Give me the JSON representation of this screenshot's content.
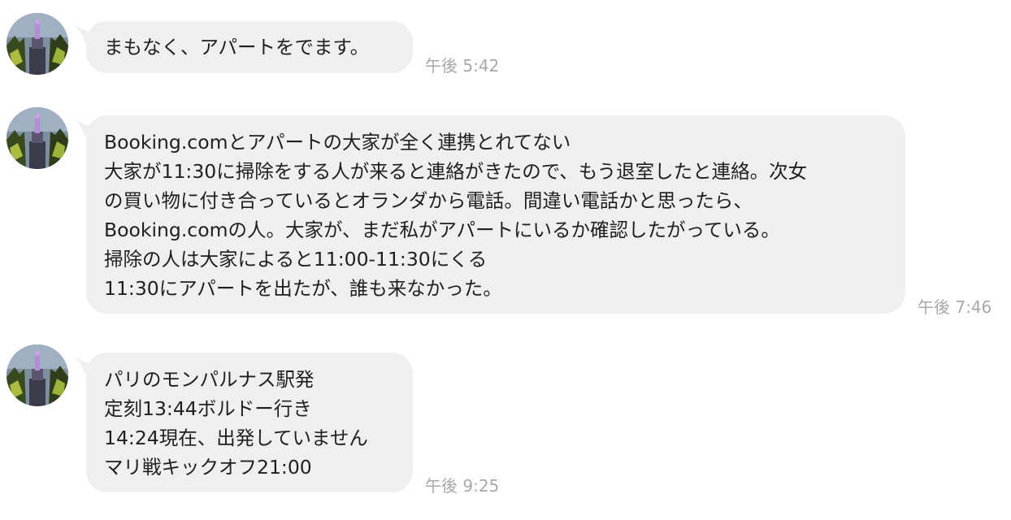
{
  "messages": [
    {
      "lines": [
        "まもなく、アパートをでます。"
      ],
      "time": "午後 5:42"
    },
    {
      "lines": [
        "Booking.comとアパートの大家が全く連携とれてない",
        "大家が11:30に掃除をする人が来ると連絡がきたので、もう退室したと連絡。次女",
        "の買い物に付き合っているとオランダから電話。間違い電話かと思ったら、",
        "Booking.comの人。大家が、まだ私がアパートにいるか確認したがっている。",
        "掃除の人は大家によると11:00-11:30にくる",
        "11:30にアパートを出たが、誰も来なかった。"
      ],
      "time": "午後 7:46"
    },
    {
      "lines": [
        "パリのモンパルナス駅発",
        "定刻13:44ボルドー行き",
        "14:24現在、出発していません",
        "マリ戦キックオフ21:00"
      ],
      "time": "午後 9:25"
    }
  ],
  "colors": {
    "bubble": "#efefef",
    "text": "#1f1f1f",
    "timestamp": "#a8a8a8"
  },
  "icons": {
    "avatar": "avatar-statue-photo-icon"
  }
}
